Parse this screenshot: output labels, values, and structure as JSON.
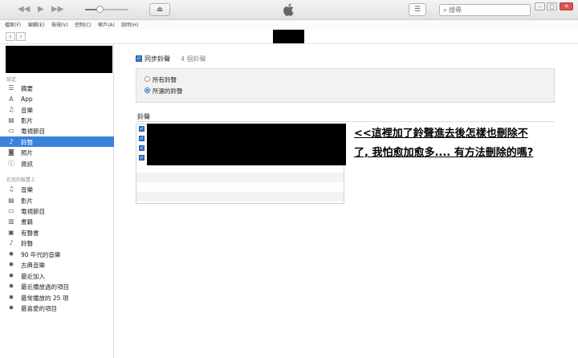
{
  "search": {
    "placeholder": "搜尋"
  },
  "menu": [
    "檔案(F)",
    "編輯(E)",
    "檢視(V)",
    "控制(C)",
    "帳戶(A)",
    "說明(H)"
  ],
  "sidebar": {
    "section_settings": "設定",
    "settings_items": [
      {
        "label": "摘要",
        "icon": "summary-icon"
      },
      {
        "label": "App",
        "icon": "app-icon"
      },
      {
        "label": "音樂",
        "icon": "music-note-icon"
      },
      {
        "label": "影片",
        "icon": "film-icon"
      },
      {
        "label": "電視節目",
        "icon": "tv-icon"
      },
      {
        "label": "鈴聲",
        "icon": "bell-icon",
        "selected": true
      },
      {
        "label": "照片",
        "icon": "camera-icon"
      },
      {
        "label": "資訊",
        "icon": "info-icon"
      }
    ],
    "section_device": "在我的裝置上",
    "device_items": [
      {
        "label": "音樂",
        "icon": "music-note-icon"
      },
      {
        "label": "影片",
        "icon": "film-icon"
      },
      {
        "label": "電視節目",
        "icon": "tv-icon"
      },
      {
        "label": "書籍",
        "icon": "book-icon"
      },
      {
        "label": "有聲書",
        "icon": "audiobook-icon"
      },
      {
        "label": "鈴聲",
        "icon": "bell-icon"
      },
      {
        "label": "90 年代的音樂",
        "icon": "gear-icon"
      },
      {
        "label": "古典音樂",
        "icon": "gear-icon"
      },
      {
        "label": "最近加入",
        "icon": "gear-icon"
      },
      {
        "label": "最近播放過的項目",
        "icon": "gear-icon"
      },
      {
        "label": "最常播放的 25 項",
        "icon": "gear-icon"
      },
      {
        "label": "最喜愛的項目",
        "icon": "gear-icon"
      }
    ]
  },
  "main": {
    "sync_label": "同步鈴聲",
    "sync_count": "4 個鈴聲",
    "radio_all": "所有鈴聲",
    "radio_selected": "所選的鈴聲",
    "tones_heading": "鈴聲",
    "annotation_line1": "<<這裡加了鈴聲進去後怎樣也刪除不",
    "annotation_line2": "了, 我怕愈加愈多.... 有方法刪除的嗎?"
  },
  "colors": {
    "accent": "#3b82dd",
    "close": "#d9534f"
  }
}
